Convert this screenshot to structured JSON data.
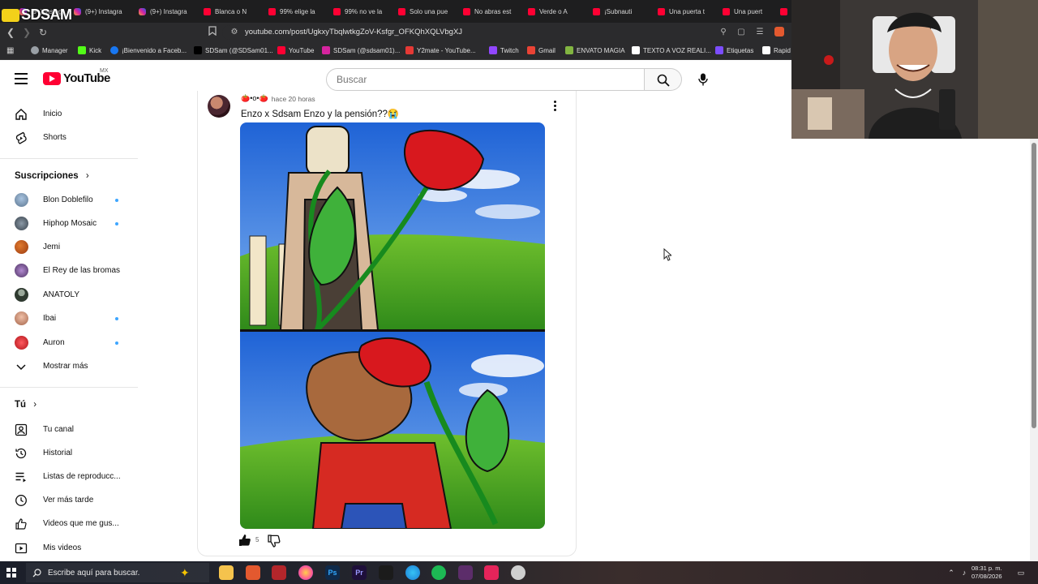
{
  "browser": {
    "overlay_logo_text": "SDSAM",
    "tabs": [
      {
        "label": "(9+) Instagra",
        "icon": "instagram-icon"
      },
      {
        "label": "(9+) Instagra",
        "icon": "instagram-icon"
      },
      {
        "label": "(9+) Instagra",
        "icon": "instagram-icon"
      },
      {
        "label": "Blanca o N",
        "icon": "youtube-icon"
      },
      {
        "label": "99% elige la",
        "icon": "youtube-icon"
      },
      {
        "label": "99% no ve la",
        "icon": "youtube-icon"
      },
      {
        "label": "Solo una pue",
        "icon": "youtube-icon"
      },
      {
        "label": "No abras est",
        "icon": "youtube-icon"
      },
      {
        "label": "Verde o A",
        "icon": "youtube-icon"
      },
      {
        "label": "¡Subnauti",
        "icon": "youtube-icon"
      },
      {
        "label": "Una puerta t",
        "icon": "youtube-icon"
      },
      {
        "label": "Una puert",
        "icon": "youtube-icon"
      }
    ],
    "url": "youtube.com/post/UgkxyTbqlwtkgZoV-Ksfgr_OFKQhXQLVbgXJ",
    "bookmarks": [
      {
        "label": "Manager",
        "icon": "manager-icon",
        "color": "#9aa0a6"
      },
      {
        "label": "Kick",
        "icon": "kick-icon",
        "color": "#53fc18"
      },
      {
        "label": "¡Bienvenido a Faceb...",
        "icon": "facebook-icon",
        "color": "#1877f2"
      },
      {
        "label": "SDSam (@SDSam01...",
        "icon": "x-icon",
        "color": "#000000"
      },
      {
        "label": "YouTube",
        "icon": "youtube-icon",
        "color": "#ff0033"
      },
      {
        "label": "SDSam (@sdsam01)...",
        "icon": "instagram-icon",
        "color": "#d6249f"
      },
      {
        "label": "Y2mate - YouTube...",
        "icon": "y2mate-icon",
        "color": "#e53935"
      },
      {
        "label": "Twitch",
        "icon": "twitch-icon",
        "color": "#9146ff"
      },
      {
        "label": "Gmail",
        "icon": "gmail-icon",
        "color": "#ea4335"
      },
      {
        "label": "ENVATO MAGIA",
        "icon": "envato-icon",
        "color": "#82b541"
      },
      {
        "label": "TEXTO A VOZ REALI...",
        "icon": "tts-icon",
        "color": "#ffffff"
      },
      {
        "label": "Etiquetas",
        "icon": "tags-icon",
        "color": "#7c4dff"
      },
      {
        "label": "Rapid",
        "icon": "rapid-icon",
        "color": "#ffffff"
      }
    ]
  },
  "youtube": {
    "logo_text": "YouTube",
    "region": "MX",
    "search_placeholder": "Buscar",
    "sidebar": {
      "main": [
        {
          "label": "Inicio",
          "icon": "home-icon"
        },
        {
          "label": "Shorts",
          "icon": "shorts-icon"
        }
      ],
      "subscriptions_title": "Suscripciones",
      "subscriptions": [
        {
          "label": "Blon Doblefilo",
          "new": true,
          "color": "#7a8fa8"
        },
        {
          "label": "Hiphop Mosaic",
          "new": true,
          "color": "#5b6b7a"
        },
        {
          "label": "Jemi",
          "new": false,
          "color": "#c2521a"
        },
        {
          "label": "El Rey de las bromas",
          "new": false,
          "color": "#6d4c8f"
        },
        {
          "label": "ANATOLY",
          "new": false,
          "color": "#3b3b3b"
        },
        {
          "label": "Ibai",
          "new": true,
          "color": "#c7927a"
        },
        {
          "label": "Auron",
          "new": true,
          "color": "#d9252a"
        }
      ],
      "show_more": "Mostrar más",
      "you_title": "Tú",
      "you_items": [
        {
          "label": "Tu canal",
          "icon": "channel-icon"
        },
        {
          "label": "Historial",
          "icon": "history-icon"
        },
        {
          "label": "Listas de reproducc...",
          "icon": "playlist-icon"
        },
        {
          "label": "Ver más tarde",
          "icon": "clock-icon"
        },
        {
          "label": "Videos que me gus...",
          "icon": "thumbs-up-icon"
        },
        {
          "label": "Mis videos",
          "icon": "my-videos-icon"
        }
      ]
    },
    "post": {
      "author": "🍅•o•🍅",
      "time": "hace 20 horas",
      "text": "Enzo x Sdsam Enzo y la pensión??😭",
      "likes": "5"
    }
  },
  "taskbar": {
    "search_placeholder": "Escribe aquí para buscar.",
    "time": "08:31 p. m.",
    "date": "07/08/2026"
  },
  "colors": {
    "youtube_red": "#ff0033",
    "subscription_dot": "#3ea6ff"
  }
}
